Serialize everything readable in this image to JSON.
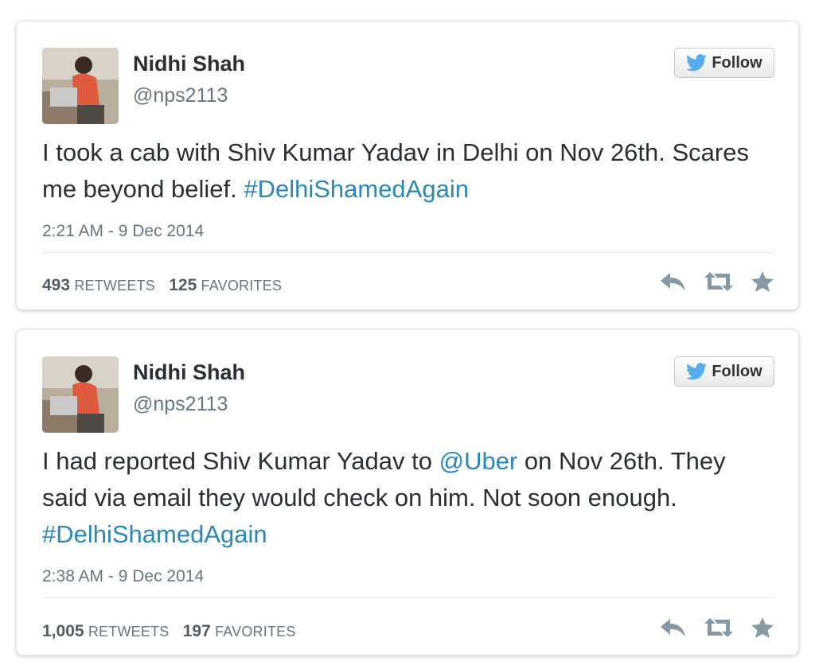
{
  "tweets": [
    {
      "name": "Nidhi Shah",
      "handle": "@nps2113",
      "follow_label": "Follow",
      "text_parts": [
        "I took a cab with Shiv Kumar Yadav in Delhi on Nov 26th. Scares me beyond belief. "
      ],
      "hashtag": "#DelhiShamedAgain",
      "timestamp": "2:21 AM - 9 Dec 2014",
      "retweets": "493",
      "retweets_label": "RETWEETS",
      "favorites": "125",
      "favorites_label": "FAVORITES"
    },
    {
      "name": "Nidhi Shah",
      "handle": "@nps2113",
      "follow_label": "Follow",
      "text_before": "I had reported Shiv Kumar Yadav to ",
      "mention": "@Uber",
      "text_after": " on Nov 26th. They said via email they would check on him. Not soon enough. ",
      "hashtag": "#DelhiShamedAgain",
      "timestamp": "2:38 AM - 9 Dec 2014",
      "retweets": "1,005",
      "retweets_label": "RETWEETS",
      "favorites": "197",
      "favorites_label": "FAVORITES"
    }
  ],
  "colors": {
    "link": "#2a87b8",
    "twitter_bird": "#55acee",
    "muted": "#66757f",
    "action_icon": "#8899a6"
  },
  "icons": [
    "twitter-bird-icon",
    "reply-icon",
    "retweet-icon",
    "favorite-star-icon"
  ]
}
